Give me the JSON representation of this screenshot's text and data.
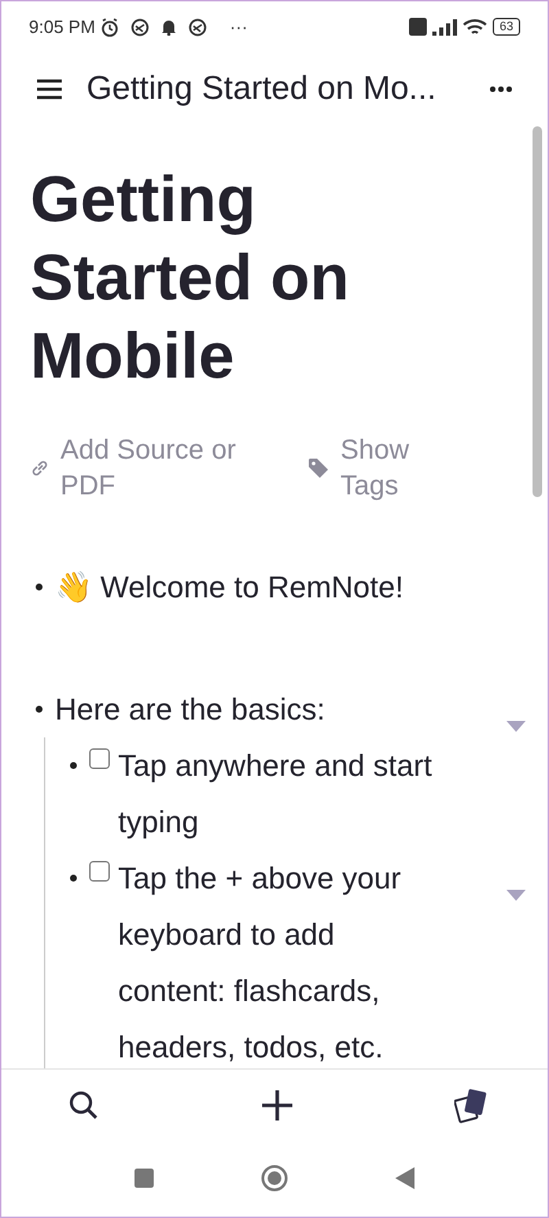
{
  "status_bar": {
    "time": "9:05 PM",
    "overflow": "···",
    "battery": "63"
  },
  "top_bar": {
    "title": "Getting Started on Mo..."
  },
  "document": {
    "title": "Getting Started on Mobile",
    "actions": [
      {
        "kind": "link",
        "label": "Add Source or PDF"
      },
      {
        "kind": "tag",
        "label": "Show Tags"
      }
    ],
    "items": [
      {
        "kind": "text",
        "emoji": "👋",
        "text": "Welcome to RemNote!"
      },
      {
        "kind": "text",
        "text": "Here are the basics:",
        "collapsible": true,
        "children": [
          {
            "kind": "todo",
            "checked": false,
            "text": "Tap anywhere and start typing"
          },
          {
            "kind": "todo",
            "checked": false,
            "text": "Tap the + above your keyboard to add content: flashcards, headers, todos, etc.",
            "collapsible": true
          }
        ]
      }
    ]
  },
  "bottom_nav": [
    {
      "kind": "search"
    },
    {
      "kind": "add"
    },
    {
      "kind": "cards"
    }
  ]
}
